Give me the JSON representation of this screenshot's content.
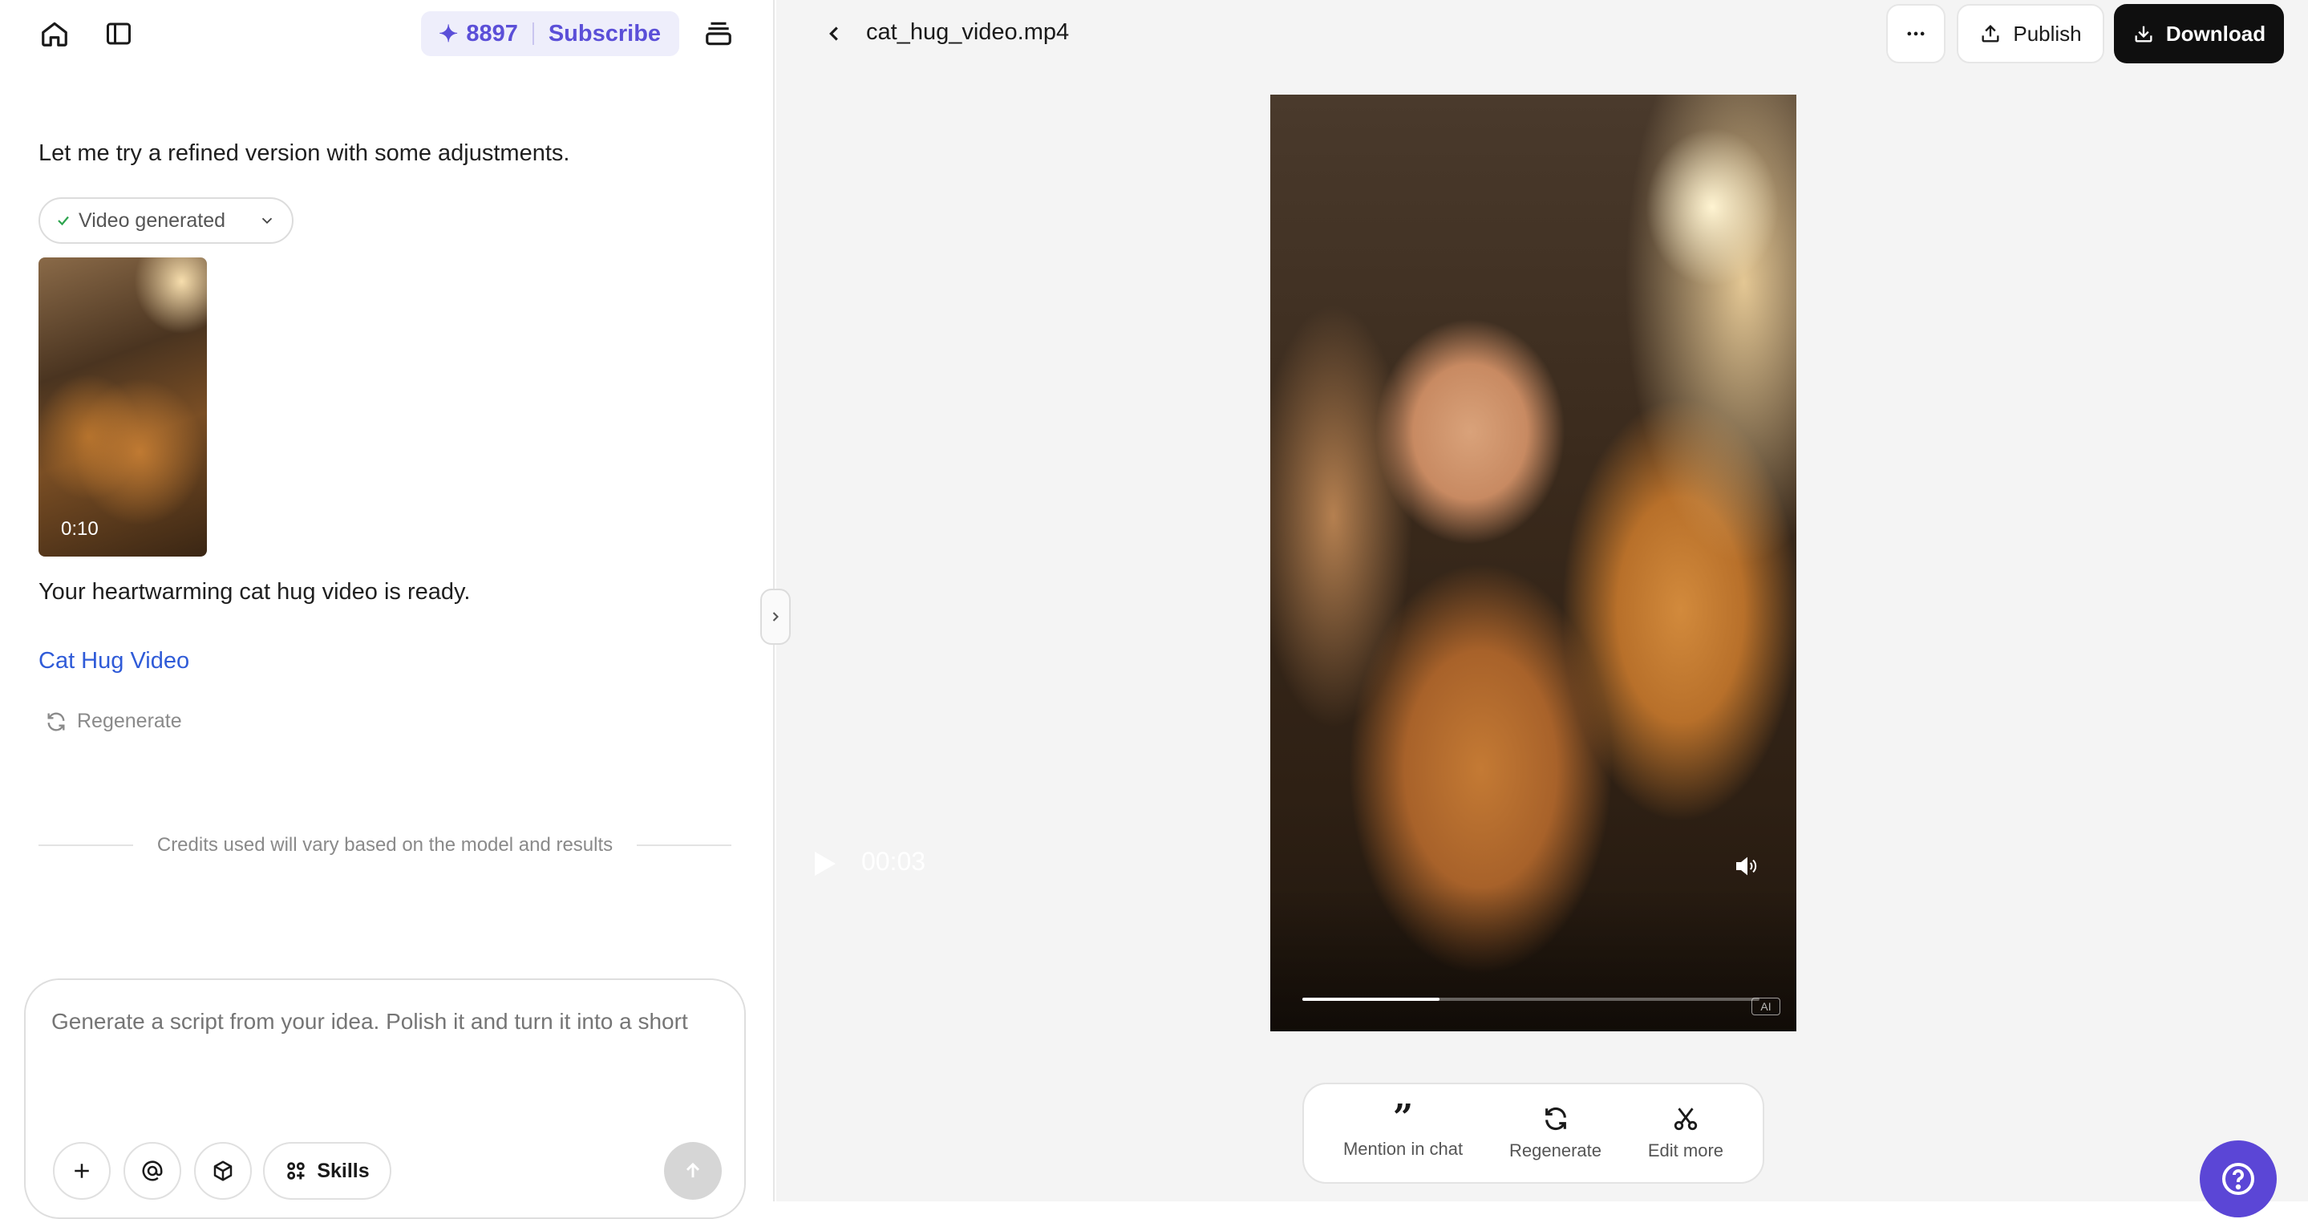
{
  "left": {
    "credits": {
      "count": "8897",
      "subscribe_label": "Subscribe"
    },
    "messages": {
      "intro": "Let me try a refined version with some adjustments.",
      "video_status": "Video generated",
      "thumbnail_duration": "0:10",
      "ready": "Your heartwarming cat hug video is ready.",
      "link": "Cat Hug Video",
      "regenerate": "Regenerate"
    },
    "note": "Credits used will vary based on the model and results",
    "composer": {
      "placeholder": "Generate a script from your idea. Polish it and turn it into a short",
      "skills_label": "Skills"
    }
  },
  "right": {
    "file_title": "cat_hug_video.mp4",
    "publish_label": "Publish",
    "download_label": "Download",
    "player": {
      "current_time": "00:03",
      "progress": 0.3,
      "ai_badge": "AI"
    },
    "actions": [
      {
        "label": "Mention in chat"
      },
      {
        "label": "Regenerate"
      },
      {
        "label": "Edit more"
      }
    ]
  },
  "icons": [
    "home-icon",
    "sidebar-toggle-icon",
    "sparkle-icon",
    "stack-icon",
    "check-icon",
    "chevron-down-icon",
    "refresh-icon",
    "plus-icon",
    "at-icon",
    "cube-icon",
    "skills-grid-icon",
    "arrow-up-icon",
    "chevron-right-icon",
    "back-chevron-icon",
    "more-icon",
    "upload-icon",
    "download-icon",
    "play-icon",
    "volume-icon",
    "quote-icon",
    "scissors-icon",
    "help-icon"
  ],
  "colors": {
    "accent": "#5b4fd8",
    "link": "#2f5bd8",
    "primary_button": "#0f0f0f",
    "help_button": "#5b46d6"
  }
}
